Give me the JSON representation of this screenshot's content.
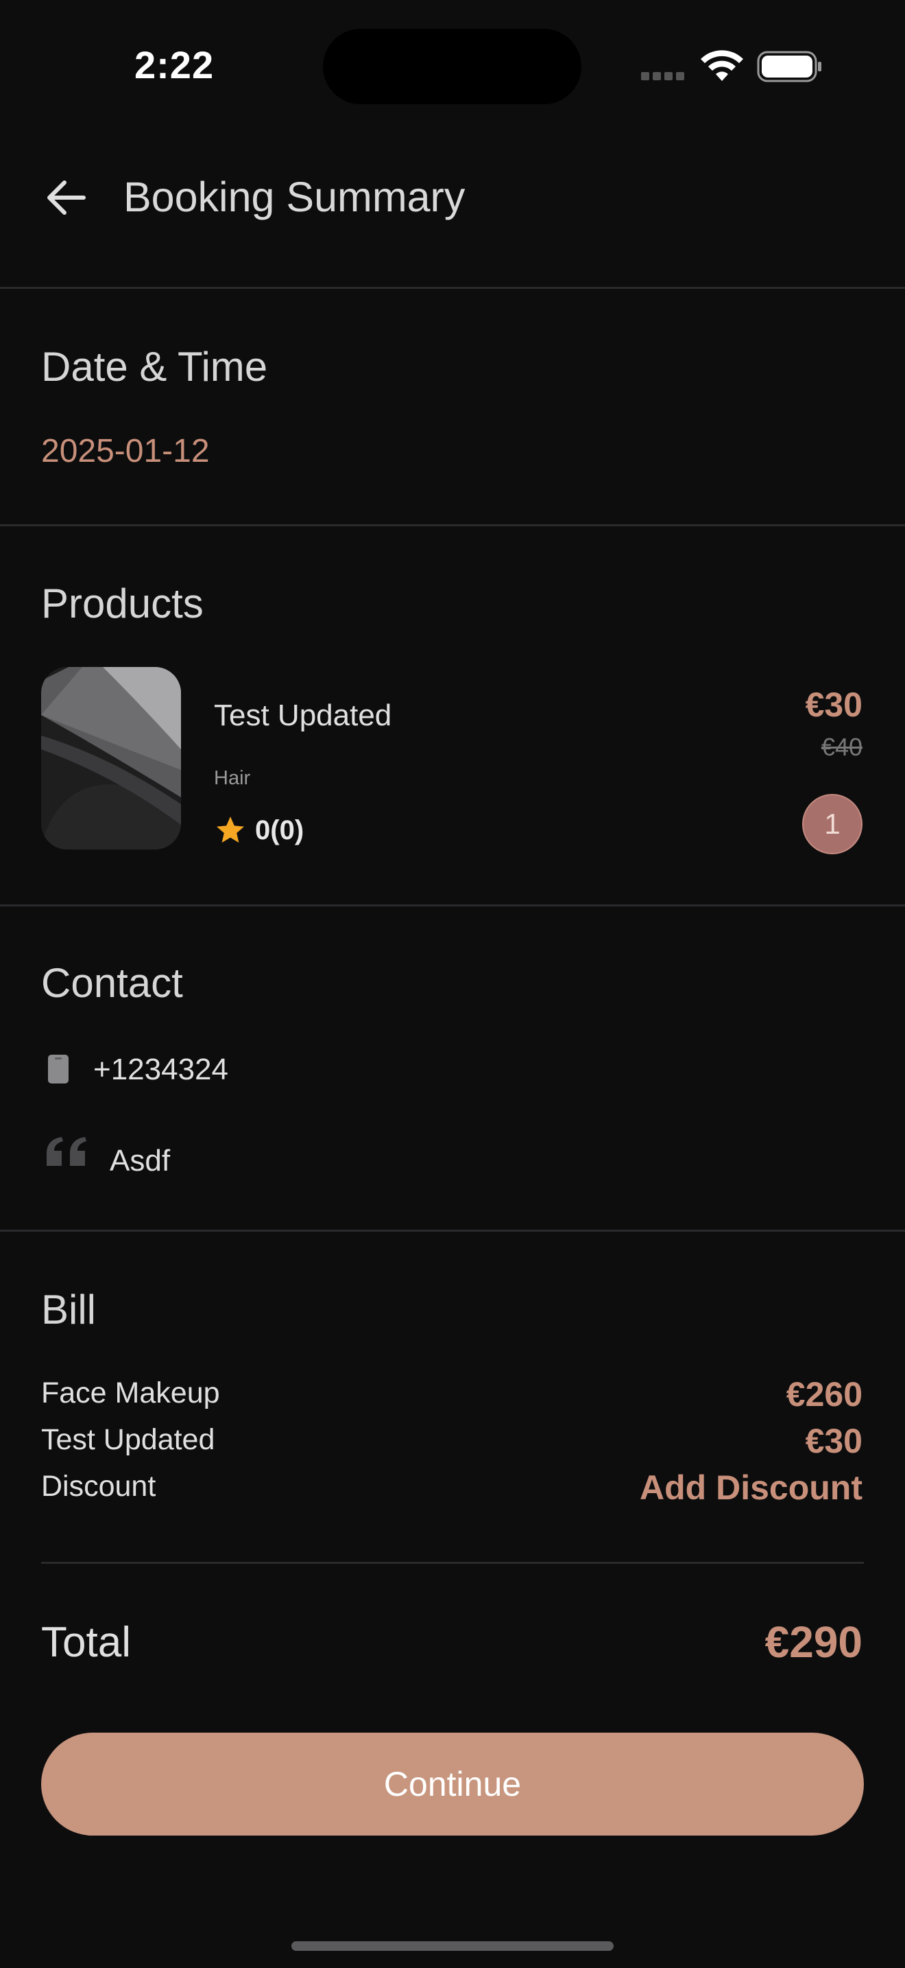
{
  "status_bar": {
    "time": "2:22"
  },
  "header": {
    "title": "Booking Summary"
  },
  "date_section": {
    "title": "Date & Time",
    "value": "2025-01-12"
  },
  "products_section": {
    "title": "Products",
    "items": [
      {
        "name": "Test Updated",
        "category": "Hair",
        "rating": "0(0)",
        "price": "€30",
        "original_price": "€40",
        "quantity": "1"
      }
    ]
  },
  "contact_section": {
    "title": "Contact",
    "phone": "+1234324",
    "note": "Asdf"
  },
  "bill_section": {
    "title": "Bill",
    "lines": [
      {
        "label": "Face Makeup",
        "value": "€260"
      },
      {
        "label": "Test Updated",
        "value": "€30"
      },
      {
        "label": "Discount",
        "value": "Add Discount"
      }
    ],
    "total_label": "Total",
    "total_value": "€290"
  },
  "continue_button": {
    "label": "Continue"
  },
  "colors": {
    "accent": "#c8907a",
    "background": "#0d0d0e",
    "button": "#c8967f",
    "star": "#f5a623"
  }
}
